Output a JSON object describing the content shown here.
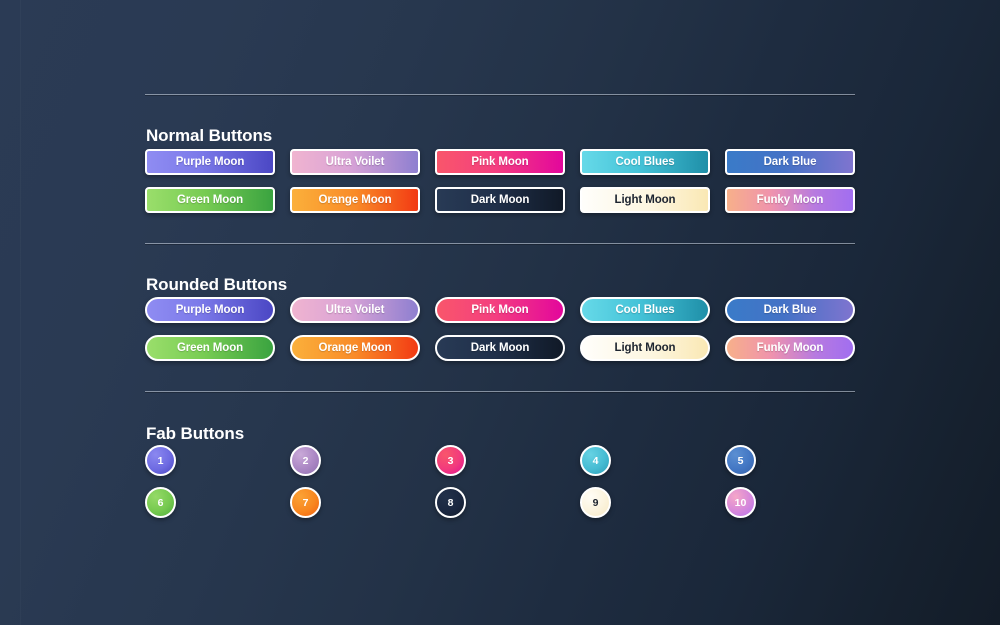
{
  "page": {
    "background_start": "#2b3b55",
    "background_end": "#131c28"
  },
  "sections": [
    {
      "id": "normal",
      "title": "Normal Buttons"
    },
    {
      "id": "rounded",
      "title": "Rounded Buttons"
    },
    {
      "id": "fab",
      "title": "Fab Buttons"
    }
  ],
  "normal_buttons": [
    {
      "label": "Purple Moon",
      "style": "g-purple",
      "text": "light"
    },
    {
      "label": "Ultra Voilet",
      "style": "g-ultra",
      "text": "light"
    },
    {
      "label": "Pink Moon",
      "style": "g-pink",
      "text": "light"
    },
    {
      "label": "Cool Blues",
      "style": "g-cool",
      "text": "light"
    },
    {
      "label": "Dark Blue",
      "style": "g-dkblue",
      "text": "light"
    },
    {
      "label": "Green Moon",
      "style": "g-green",
      "text": "light"
    },
    {
      "label": "Orange Moon",
      "style": "g-orange",
      "text": "light"
    },
    {
      "label": "Dark Moon",
      "style": "g-dark",
      "text": "light"
    },
    {
      "label": "Light Moon",
      "style": "g-light",
      "text": "dark"
    },
    {
      "label": "Funky Moon",
      "style": "g-funky",
      "text": "light"
    }
  ],
  "rounded_buttons": [
    {
      "label": "Purple Moon",
      "style": "g-purple",
      "text": "light"
    },
    {
      "label": "Ultra Voilet",
      "style": "g-ultra",
      "text": "light"
    },
    {
      "label": "Pink Moon",
      "style": "g-pink",
      "text": "light"
    },
    {
      "label": "Cool Blues",
      "style": "g-cool",
      "text": "light"
    },
    {
      "label": "Dark Blue",
      "style": "g-dkblue",
      "text": "light"
    },
    {
      "label": "Green Moon",
      "style": "g-green",
      "text": "light"
    },
    {
      "label": "Orange Moon",
      "style": "g-orange",
      "text": "light"
    },
    {
      "label": "Dark Moon",
      "style": "g-dark",
      "text": "light"
    },
    {
      "label": "Light Moon",
      "style": "g-light",
      "text": "dark"
    },
    {
      "label": "Funky Moon",
      "style": "g-funky",
      "text": "light"
    }
  ],
  "fab_buttons": [
    {
      "label": "1",
      "style": "f-purple",
      "text": "light"
    },
    {
      "label": "2",
      "style": "f-ultra",
      "text": "light"
    },
    {
      "label": "3",
      "style": "f-pink",
      "text": "light"
    },
    {
      "label": "4",
      "style": "f-cool",
      "text": "light"
    },
    {
      "label": "5",
      "style": "f-dkblue",
      "text": "light"
    },
    {
      "label": "6",
      "style": "f-green",
      "text": "light"
    },
    {
      "label": "7",
      "style": "f-orange",
      "text": "light"
    },
    {
      "label": "8",
      "style": "f-dark",
      "text": "light"
    },
    {
      "label": "9",
      "style": "f-light",
      "text": "dark"
    },
    {
      "label": "10",
      "style": "f-funky",
      "text": "light"
    }
  ]
}
